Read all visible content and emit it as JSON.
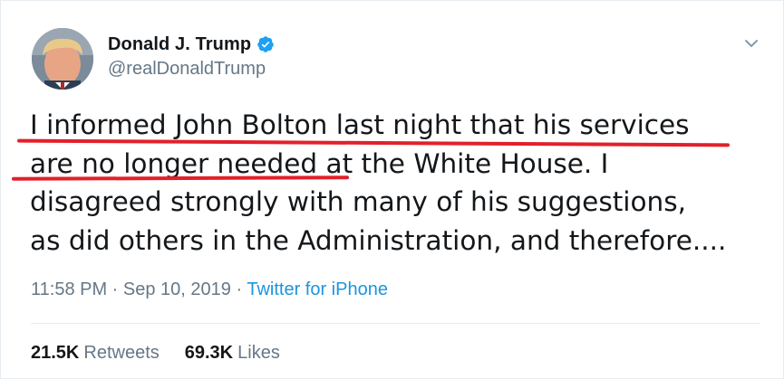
{
  "user": {
    "display_name": "Donald J. Trump",
    "handle": "@realDonaldTrump",
    "verified_color": "#1da1f2"
  },
  "tweet": {
    "lines": [
      "I informed John Bolton last night that his services",
      "are no longer needed at the White House. I",
      "disagreed strongly with many of his suggestions,",
      "as did others in the Administration, and therefore...."
    ]
  },
  "meta": {
    "time": "11:58 PM",
    "separator": " · ",
    "date": "Sep 10, 2019",
    "source": "Twitter for iPhone"
  },
  "stats": {
    "retweets_count": "21.5K",
    "retweets_label": "Retweets",
    "likes_count": "69.3K",
    "likes_label": "Likes"
  },
  "colors": {
    "annotation": "#e2202a",
    "link": "#1b95e0",
    "muted": "#657786"
  },
  "icons": {
    "verified": "verified-badge-icon",
    "caret": "chevron-down-icon"
  }
}
